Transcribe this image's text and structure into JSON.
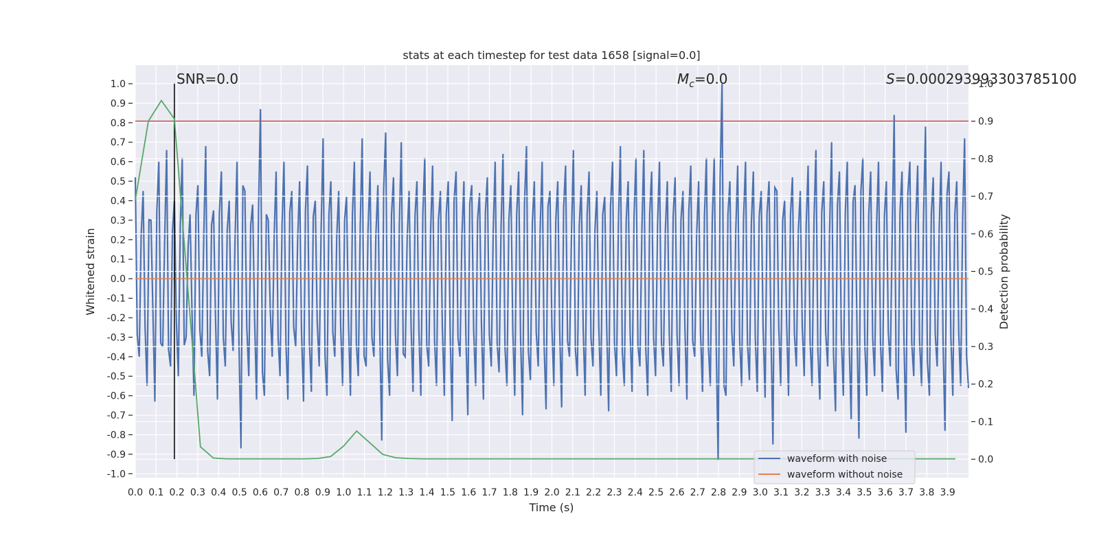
{
  "chart_data": {
    "type": "line",
    "title": "stats at each timestep for test data 1658 [signal=0.0]",
    "xlabel": "Time (s)",
    "ylabel": "Whitened strain",
    "ylabel_right": "Detection probability",
    "xlim": [
      0.0,
      4.0
    ],
    "ylim": [
      -1.02,
      1.095
    ],
    "ylim_right": [
      -0.049,
      1.049
    ],
    "xticks": [
      0.0,
      0.1,
      0.2,
      0.3,
      0.4,
      0.5,
      0.6,
      0.7,
      0.8,
      0.9,
      1.0,
      1.1,
      1.2,
      1.3,
      1.4,
      1.5,
      1.6,
      1.7,
      1.8,
      1.9,
      2.0,
      2.1,
      2.2,
      2.3,
      2.4,
      2.5,
      2.6,
      2.7,
      2.8,
      2.9,
      3.0,
      3.1,
      3.2,
      3.3,
      3.4,
      3.5,
      3.6,
      3.7,
      3.8,
      3.9
    ],
    "yticks": [
      -1.0,
      -0.9,
      -0.8,
      -0.7,
      -0.6,
      -0.5,
      -0.4,
      -0.3,
      -0.2,
      -0.1,
      0.0,
      0.1,
      0.2,
      0.3,
      0.4,
      0.5,
      0.6,
      0.7,
      0.8,
      0.9,
      1.0
    ],
    "yticks_right": [
      0.0,
      0.1,
      0.2,
      0.3,
      0.4,
      0.5,
      0.6,
      0.7,
      0.8,
      0.9,
      1.0
    ],
    "grid": true,
    "legend_position": "lower-right",
    "annotations": {
      "snr": "SNR=0.0",
      "mc_symbol": "M",
      "mc_sub": "c",
      "mc_rest": "=0.0",
      "s_symbol": "S",
      "s_rest": "=0.000293993303785100"
    },
    "series": [
      {
        "name": "waveform with noise",
        "color": "#4c72b0",
        "axis": "left",
        "x_range": [
          0.0,
          4.0
        ],
        "values": [
          0.52,
          -0.4,
          0.45,
          -0.55,
          0.3,
          -0.63,
          0.6,
          -0.35,
          0.66,
          -0.45,
          0.4,
          -0.5,
          0.62,
          -0.3,
          0.33,
          -0.6,
          0.48,
          -0.4,
          0.68,
          -0.5,
          0.35,
          -0.62,
          0.55,
          -0.45,
          0.4,
          -0.37,
          0.6,
          -0.87,
          0.45,
          -0.5,
          0.38,
          -0.62,
          0.87,
          -0.6,
          0.3,
          -0.4,
          0.55,
          -0.5,
          0.6,
          -0.62,
          0.45,
          -0.35,
          0.5,
          -0.63,
          0.58,
          -0.58,
          0.4,
          -0.45,
          0.72,
          -0.6,
          0.5,
          -0.4,
          0.45,
          -0.55,
          0.42,
          -0.6,
          0.6,
          -0.5,
          0.72,
          -0.45,
          0.55,
          -0.4,
          0.48,
          -0.83,
          0.75,
          -0.6,
          0.52,
          -0.5,
          0.7,
          -0.4,
          0.45,
          -0.58,
          0.5,
          -0.6,
          0.62,
          -0.45,
          0.58,
          -0.55,
          0.45,
          -0.6,
          0.5,
          -0.73,
          0.55,
          -0.4,
          0.5,
          -0.7,
          0.48,
          -0.55,
          0.44,
          -0.62,
          0.52,
          -0.45,
          0.6,
          -0.48,
          0.64,
          -0.55,
          0.48,
          -0.6,
          0.55,
          -0.7,
          0.68,
          -0.52,
          0.5,
          -0.45,
          0.6,
          -0.67,
          0.45,
          -0.55,
          0.5,
          -0.66,
          0.58,
          -0.4,
          0.66,
          -0.5,
          0.48,
          -0.6,
          0.55,
          -0.45,
          0.45,
          -0.6,
          0.42,
          -0.68,
          0.6,
          -0.5,
          0.68,
          -0.55,
          0.5,
          -0.58,
          0.62,
          -0.45,
          0.66,
          -0.6,
          0.55,
          -0.5,
          0.6,
          -0.45,
          0.5,
          -0.58,
          0.52,
          -0.55,
          0.45,
          -0.62,
          0.58,
          -0.4,
          0.5,
          -0.58,
          0.62,
          -0.55,
          0.62,
          -0.93,
          1.0,
          -0.6,
          0.5,
          -0.45,
          0.58,
          -0.55,
          0.6,
          -0.52,
          0.55,
          -0.58,
          0.45,
          -0.61,
          0.5,
          -0.85,
          0.45,
          -0.55,
          0.4,
          -0.6,
          0.52,
          -0.45,
          0.45,
          -0.5,
          0.58,
          -0.55,
          0.66,
          -0.62,
          0.5,
          -0.45,
          0.7,
          -0.68,
          0.55,
          -0.6,
          0.6,
          -0.72,
          0.48,
          -0.82,
          0.62,
          -0.6,
          0.55,
          -0.5,
          0.6,
          -0.58,
          0.5,
          -0.45,
          0.84,
          -0.62,
          0.55,
          -0.79,
          0.6,
          -0.5,
          0.58,
          -0.55,
          0.78,
          -0.6,
          0.52,
          -0.45,
          0.6,
          -0.78,
          0.55,
          -0.6,
          0.5,
          -0.55,
          0.72,
          -0.56
        ]
      },
      {
        "name": "waveform without noise",
        "color": "#dd8452",
        "axis": "left",
        "x_range": [
          0.0,
          4.0
        ],
        "values": [
          0.0,
          0.0
        ]
      },
      {
        "color": "#55a868",
        "axis": "right",
        "x_start": 0.0,
        "x_step": 0.0625,
        "values": [
          0.69,
          0.9,
          0.955,
          0.906,
          0.47,
          0.033,
          0.003,
          0.001,
          0.001,
          0.001,
          0.001,
          0.001,
          0.001,
          0.001,
          0.002,
          0.007,
          0.035,
          0.075,
          0.044,
          0.013,
          0.004,
          0.002,
          0.001,
          0.001,
          0.001,
          0.001,
          0.001,
          0.001,
          0.001,
          0.001,
          0.001,
          0.001,
          0.001,
          0.001,
          0.001,
          0.001,
          0.001,
          0.001,
          0.001,
          0.001,
          0.001,
          0.001,
          0.001,
          0.001,
          0.001,
          0.001,
          0.001,
          0.001,
          0.001,
          0.001,
          0.001,
          0.001,
          0.001,
          0.001,
          0.001,
          0.001,
          0.001,
          0.001,
          0.001,
          0.001,
          0.001,
          0.001,
          0.001,
          0.001
        ]
      }
    ],
    "threshold": {
      "value": 0.9,
      "axis": "right",
      "color": "#c44e52"
    },
    "marker_line": {
      "x": 0.1875,
      "ymin": 0.0,
      "ymax": 1.0,
      "axis": "right",
      "color": "#000000"
    }
  }
}
